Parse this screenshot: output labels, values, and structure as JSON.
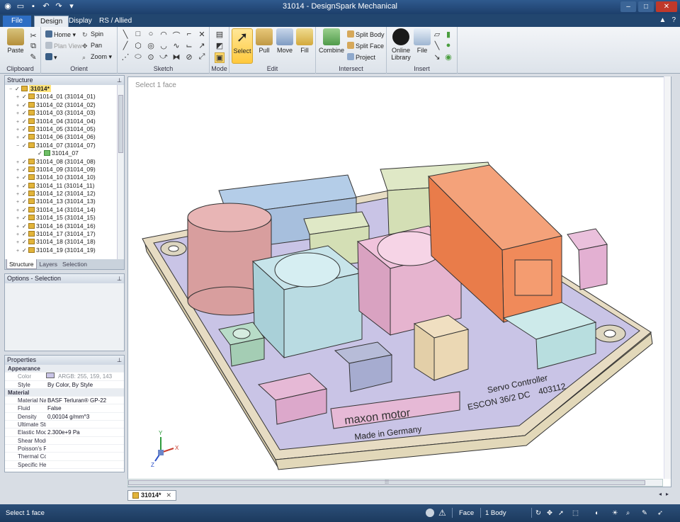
{
  "window": {
    "title": "31014 - DesignSpark Mechanical"
  },
  "tabs": [
    {
      "label": "File"
    },
    {
      "label": "Design"
    },
    {
      "label": "Display"
    },
    {
      "label": "RS / Allied"
    }
  ],
  "ribbon": {
    "clipboard": {
      "label": "Clipboard",
      "paste": "Paste"
    },
    "orient": {
      "label": "Orient",
      "home": "Home",
      "spin": "Spin",
      "plan_view": "Plan View",
      "pan": "Pan",
      "zoom": "Zoom"
    },
    "sketch": {
      "label": "Sketch"
    },
    "mode": {
      "label": "Mode"
    },
    "edit": {
      "label": "Edit",
      "select": "Select",
      "pull": "Pull",
      "move": "Move",
      "fill": "Fill"
    },
    "intersect": {
      "label": "Intersect",
      "combine": "Combine",
      "split_body": "Split Body",
      "split_face": "Split Face",
      "project": "Project"
    },
    "insert": {
      "label": "Insert",
      "online_library_1": "Online",
      "online_library_2": "Library",
      "file": "File"
    }
  },
  "structure": {
    "title": "Structure",
    "root": "31014*",
    "items": [
      {
        "label": "31014_01 (31014_01)",
        "expand": "+"
      },
      {
        "label": "31014_02 (31014_02)",
        "expand": "+"
      },
      {
        "label": "31014_03 (31014_03)",
        "expand": "+"
      },
      {
        "label": "31014_04 (31014_04)",
        "expand": "+"
      },
      {
        "label": "31014_05 (31014_05)",
        "expand": "+"
      },
      {
        "label": "31014_06 (31014_06)",
        "expand": "+"
      },
      {
        "label": "31014_07 (31014_07)",
        "expand": "−"
      },
      {
        "label": "31014_07",
        "expand": "",
        "child": true
      },
      {
        "label": "31014_08 (31014_08)",
        "expand": "+"
      },
      {
        "label": "31014_09 (31014_09)",
        "expand": "+"
      },
      {
        "label": "31014_10 (31014_10)",
        "expand": "+"
      },
      {
        "label": "31014_11 (31014_11)",
        "expand": "+"
      },
      {
        "label": "31014_12 (31014_12)",
        "expand": "+"
      },
      {
        "label": "31014_13 (31014_13)",
        "expand": "+"
      },
      {
        "label": "31014_14 (31014_14)",
        "expand": "+"
      },
      {
        "label": "31014_15 (31014_15)",
        "expand": "+"
      },
      {
        "label": "31014_16 (31014_16)",
        "expand": "+"
      },
      {
        "label": "31014_17 (31014_17)",
        "expand": "+"
      },
      {
        "label": "31014_18 (31014_18)",
        "expand": "+"
      },
      {
        "label": "31014_19 (31014_19)",
        "expand": "+"
      }
    ],
    "panel_tabs": [
      "Structure",
      "Layers",
      "Selection"
    ]
  },
  "options": {
    "title": "Options - Selection"
  },
  "properties": {
    "title": "Properties",
    "rows": [
      {
        "type": "cat",
        "key": "Appearance",
        "value": ""
      },
      {
        "type": "dim",
        "key": "Color",
        "value": "ARGB: 255, 159, 143"
      },
      {
        "type": "row",
        "key": "Style",
        "value": "By Color, By Style"
      },
      {
        "type": "cat",
        "key": "Material",
        "value": ""
      },
      {
        "type": "row",
        "key": "Material Name",
        "value": "BASF Terluran® GP-22"
      },
      {
        "type": "row",
        "key": "Fluid",
        "value": "False"
      },
      {
        "type": "row",
        "key": "Density",
        "value": "0,00104 g/mm^3"
      },
      {
        "type": "row",
        "key": "Ultimate Str",
        "value": ""
      },
      {
        "type": "row",
        "key": "Elastic Mod",
        "value": "2.300e+9 Pa"
      },
      {
        "type": "row",
        "key": "Shear Modu",
        "value": ""
      },
      {
        "type": "row",
        "key": "Poisson's R",
        "value": ""
      },
      {
        "type": "row",
        "key": "Thermal Co",
        "value": ""
      },
      {
        "type": "row",
        "key": "Specific He",
        "value": ""
      }
    ]
  },
  "viewport": {
    "hint": "Select 1 face",
    "label_brand": "maxon motor",
    "label_made": "Made in Germany",
    "label_product": "Servo Controller",
    "label_model": "ESCON 36/2 DC",
    "label_number": "403112",
    "axis_x": "X",
    "axis_y": "Y",
    "axis_z": "Z"
  },
  "doc_tab": {
    "label": "31014*"
  },
  "status": {
    "message": "Select 1 face",
    "select_filter": "Face",
    "count": "1 Body"
  },
  "colors": {
    "base_plate": "#c9c4e6",
    "frame": "#e7dcc3",
    "capacitor": "#e0a8a8",
    "inductor_blue": "#b9dbe2",
    "inductor_pink": "#e6b4cf",
    "connector_orange": "#f08a5a",
    "connector_green": "#dfe8c6",
    "connector_blue": "#b4cde8",
    "label_pink": "#e6b9d6"
  }
}
